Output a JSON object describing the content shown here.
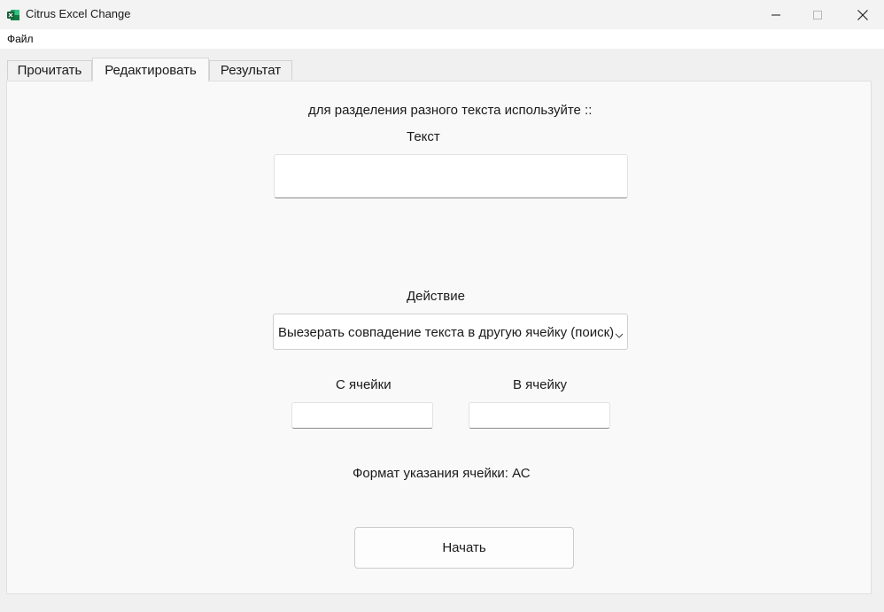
{
  "window": {
    "title": "Citrus Excel Change"
  },
  "menu": {
    "items": [
      {
        "label": "Файл"
      }
    ]
  },
  "tabs": [
    {
      "label": "Прочитать",
      "active": false
    },
    {
      "label": "Редактировать",
      "active": true
    },
    {
      "label": "Результат",
      "active": false
    }
  ],
  "edit": {
    "hint": "для разделения разного текста используйте  ::",
    "text_label": "Текст",
    "text_value": "",
    "action_label": "Действие",
    "action_selected": "Выезерать совпадение текста в другую ячейку (поиск)",
    "from_label": "С ячейки",
    "from_value": "",
    "to_label": "В ячейку",
    "to_value": "",
    "format_hint": "Формат указания ячейки: АС",
    "start_button": "Начать"
  },
  "icons": {
    "app": "excel-icon",
    "minimize": "minimize-icon",
    "maximize": "maximize-icon",
    "close": "close-icon",
    "dropdown": "chevron-down-icon"
  },
  "colors": {
    "app_icon_green": "#1d6f42",
    "panel_background": "#f9f9f9",
    "window_background": "#f0f0f0"
  }
}
